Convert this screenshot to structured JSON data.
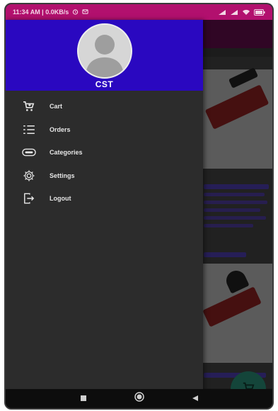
{
  "status_bar": {
    "left_text": "11:34 AM | 0.0KB/s",
    "alarm_icon": "alarm-icon",
    "msg_icon": "message-icon",
    "signal_icon": "signal-icon",
    "wifi_icon": "wifi-icon",
    "battery_icon": "battery-icon"
  },
  "drawer": {
    "user_name": "CST",
    "menu": [
      {
        "label": "Cart",
        "icon": "cart-icon"
      },
      {
        "label": "Orders",
        "icon": "orders-list-icon"
      },
      {
        "label": "Categories",
        "icon": "categories-icon"
      },
      {
        "label": "Settings",
        "icon": "settings-gear-icon"
      },
      {
        "label": "Logout",
        "icon": "logout-icon"
      }
    ]
  },
  "fab": {
    "icon": "cart-icon"
  },
  "nav_bar": {
    "buttons": [
      "recents-square-icon",
      "home-circle-icon",
      "back-triangle-icon"
    ]
  },
  "colors": {
    "status_bar": "#b2106e",
    "drawer_header": "#2a08c0",
    "drawer_bg": "#2c2c2c",
    "fab": "#1f6b5a"
  }
}
